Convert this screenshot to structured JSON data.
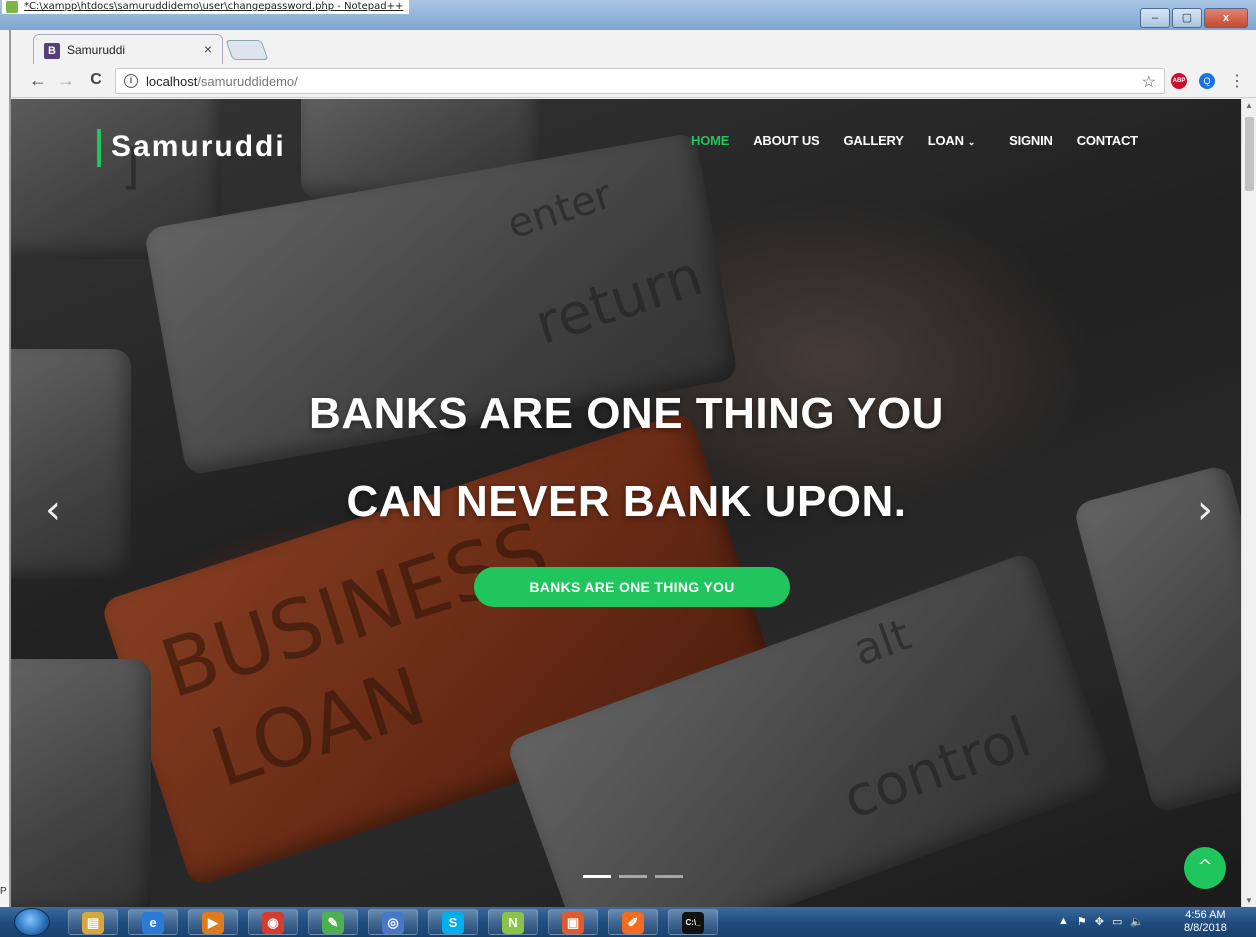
{
  "background_window": {
    "title": "*C:\\xampp\\htdocs\\samuruddidemo\\user\\changepassword.php - Notepad++",
    "controls": [
      "–",
      "▢",
      "x"
    ]
  },
  "browser": {
    "tab_title": "Samuruddi",
    "tab_favicon": "B",
    "tab_close": "×",
    "url_host": "localhost",
    "url_path": "/samuruddidemo/",
    "back_icon": "←",
    "forward_icon": "→",
    "reload_icon": "C",
    "info_icon": "i",
    "star_icon": "☆",
    "abp_label": "ABP",
    "ext_label": "Q",
    "menu_icon": "⋮"
  },
  "site": {
    "brand": "Samuruddi",
    "nav": [
      {
        "label": "HOME",
        "active": true
      },
      {
        "label": "ABOUT US",
        "active": false
      },
      {
        "label": "GALLERY",
        "active": false
      },
      {
        "label": "LOAN",
        "active": false,
        "caret": "⌄"
      },
      {
        "label": "SIGNIN",
        "active": false
      },
      {
        "label": "CONTACT",
        "active": false
      }
    ],
    "hero": {
      "headline_line1": "BANKS ARE ONE THING YOU",
      "headline_line2": "CAN NEVER BANK UPON.",
      "cta_label": "BANKS ARE ONE THING YOU",
      "prev_icon": "‹",
      "next_icon": "›",
      "slide_count": 3,
      "active_slide": 1,
      "key_labels": {
        "enter": "enter",
        "return": "return",
        "business": "BUSINESS",
        "loan": "LOAN",
        "alt": "alt",
        "control": "control",
        "bracket": "]"
      }
    },
    "back_to_top_icon": "^",
    "accent_color": "#21c55d"
  },
  "taskbar": {
    "apps": [
      {
        "name": "file-explorer",
        "glyph": "▤",
        "color": "#d9a63a"
      },
      {
        "name": "internet-explorer",
        "glyph": "e",
        "color": "#2b7bd6"
      },
      {
        "name": "media-player",
        "glyph": "▶",
        "color": "#e07a1f"
      },
      {
        "name": "chrome",
        "glyph": "◉",
        "color": "#d63b2f"
      },
      {
        "name": "leaf-app",
        "glyph": "✎",
        "color": "#4caf50"
      },
      {
        "name": "chrome-alt",
        "glyph": "◎",
        "color": "#4a78c9"
      },
      {
        "name": "skype",
        "glyph": "S",
        "color": "#00aff0"
      },
      {
        "name": "notepad-plus-plus",
        "glyph": "N",
        "color": "#8bc34a"
      },
      {
        "name": "presentation-app",
        "glyph": "▣",
        "color": "#e05a2b"
      },
      {
        "name": "paint-app",
        "glyph": "✐",
        "color": "#f26b21"
      },
      {
        "name": "command-prompt",
        "glyph": "C:\\_",
        "color": "#111111"
      }
    ],
    "tray_icons": [
      "▲",
      "⚑",
      "✥",
      "▭",
      "🔈"
    ],
    "time": "4:56 AM",
    "date": "8/8/2018"
  },
  "left_edge_text": "P"
}
